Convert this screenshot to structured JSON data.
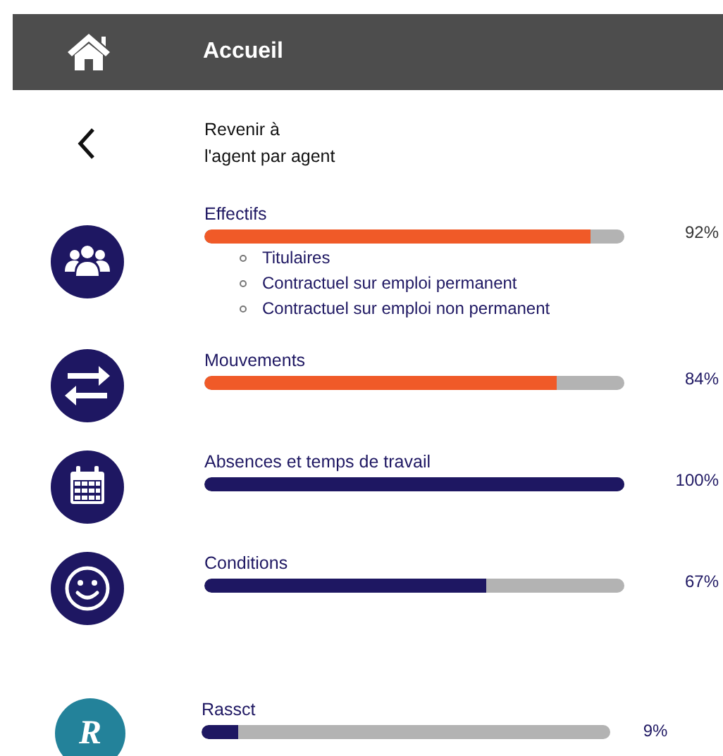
{
  "header": {
    "title": "Accueil"
  },
  "back_link": {
    "lines": [
      "Revenir à",
      "l'agent par agent"
    ]
  },
  "themes": [
    {
      "kind": "people",
      "label": "Effectifs",
      "level": 0.92,
      "color": "#f05a28",
      "reading": "92%",
      "sub_items": [
        "Titulaires",
        "Contractuel sur emploi permanent",
        "Contractuel sur emploi non permanent"
      ]
    },
    {
      "kind": "arrows",
      "label": "Mouvements",
      "level": 0.84,
      "color": "#f05a28",
      "reading": "84%"
    },
    {
      "kind": "calendar",
      "label": "Absences et temps de travail",
      "level": 1.0,
      "color": "#1e1762",
      "reading": "100%"
    },
    {
      "kind": "smiley",
      "label": "Conditions",
      "level": 0.67,
      "color": "#1e1762",
      "reading": "67%"
    },
    {
      "kind": "letter",
      "badge": "R",
      "label": "Rassct",
      "level": 0.09,
      "color": "#1e1762",
      "reading": "9%"
    }
  ]
}
